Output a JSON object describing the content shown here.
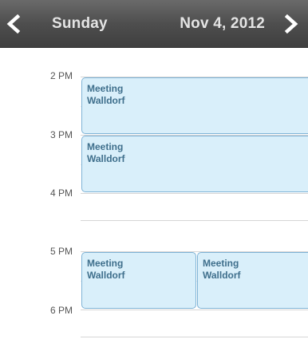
{
  "header": {
    "day": "Sunday",
    "date": "Nov 4, 2012",
    "prev_icon": "chevron-left-icon",
    "next_icon": "chevron-right-icon"
  },
  "hours": [
    "2 PM",
    "3 PM",
    "4 PM",
    "5 PM",
    "6 PM"
  ],
  "events": [
    {
      "title": "Meeting",
      "location": "Walldorf",
      "start": "2 PM",
      "end": "3 PM"
    },
    {
      "title": "Meeting",
      "location": "Walldorf",
      "start": "3 PM",
      "end": "4 PM"
    },
    {
      "title": "Meeting",
      "location": "Walldorf",
      "start": "5 PM",
      "end": "6 PM"
    },
    {
      "title": "Meeting",
      "location": "Walldorf",
      "start": "5 PM",
      "end": "6 PM"
    }
  ],
  "colors": {
    "header_bg": "#4e4e4e",
    "header_text": "#e4e4e4",
    "event_bg": "#d9effa",
    "event_border": "#7eb3d6",
    "event_text": "#3f6f8c"
  }
}
